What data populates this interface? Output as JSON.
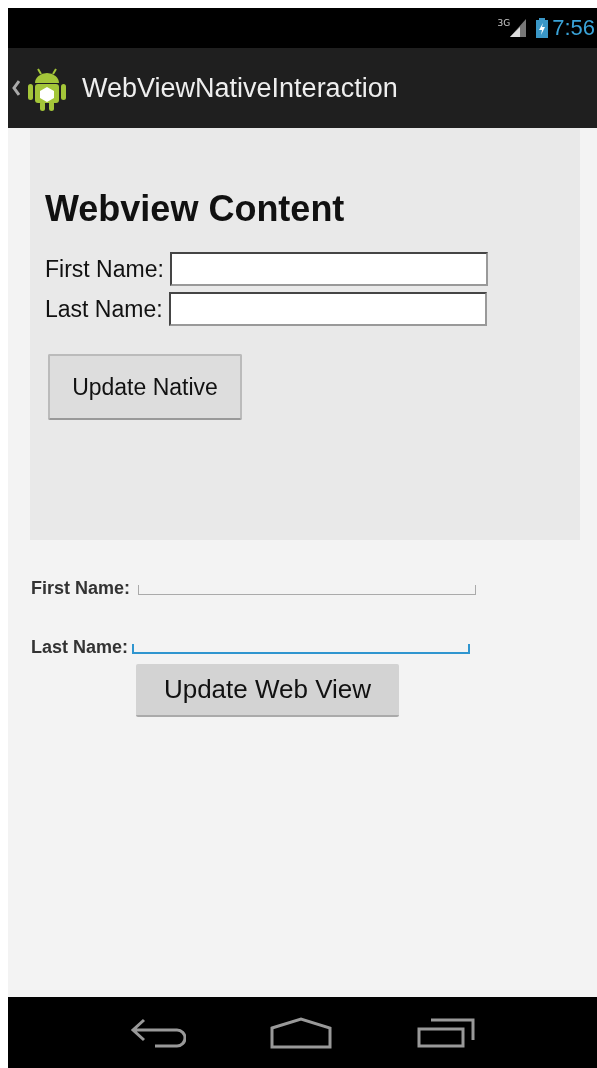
{
  "status_bar": {
    "network": "3G",
    "time": "7:56"
  },
  "action_bar": {
    "title": "WebViewNativeInteraction"
  },
  "webview": {
    "heading": "Webview Content",
    "fields": [
      {
        "label": "First Name:"
      },
      {
        "label": "Last Name:"
      }
    ],
    "button": "Update Native"
  },
  "native": {
    "fields": [
      {
        "label": "First Name:",
        "focused": false
      },
      {
        "label": "Last Name:",
        "focused": true
      }
    ],
    "button": "Update Web View"
  }
}
